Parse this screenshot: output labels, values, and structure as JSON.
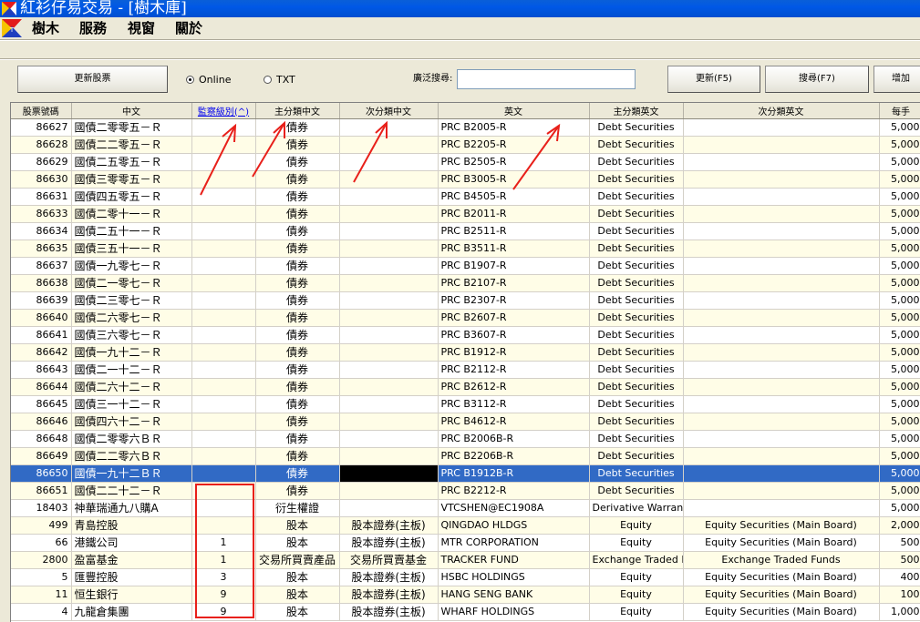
{
  "window": {
    "title": "紅衫仔易交易 - [樹木庫]"
  },
  "menu": [
    "樹木",
    "服務",
    "視窗",
    "關於"
  ],
  "toolbar": {
    "refresh_stocks": "更新股票",
    "online_label": "Online",
    "txt_label": "TXT",
    "search_label": "廣泛搜尋:",
    "search_value": "",
    "update_label": "更新(F5)",
    "search_label_btn": "搜尋(F7)",
    "add_label": "增加"
  },
  "table": {
    "columns": [
      "股票號碼",
      "中文",
      "監察級別(^)",
      "主分類中文",
      "次分類中文",
      "英文",
      "主分類英文",
      "次分類英文",
      "每手"
    ],
    "rows": [
      [
        "86627",
        "國債二零零五－Ｒ",
        "",
        "債券",
        "",
        "PRC B2005-R",
        "Debt Securities",
        "",
        "5,000"
      ],
      [
        "86628",
        "國債二二零五－Ｒ",
        "",
        "債券",
        "",
        "PRC B2205-R",
        "Debt Securities",
        "",
        "5,000"
      ],
      [
        "86629",
        "國債二五零五－Ｒ",
        "",
        "債券",
        "",
        "PRC B2505-R",
        "Debt Securities",
        "",
        "5,000"
      ],
      [
        "86630",
        "國債三零零五－Ｒ",
        "",
        "債券",
        "",
        "PRC B3005-R",
        "Debt Securities",
        "",
        "5,000"
      ],
      [
        "86631",
        "國債四五零五－Ｒ",
        "",
        "債券",
        "",
        "PRC B4505-R",
        "Debt Securities",
        "",
        "5,000"
      ],
      [
        "86633",
        "國債二零十一－Ｒ",
        "",
        "債券",
        "",
        "PRC B2011-R",
        "Debt Securities",
        "",
        "5,000"
      ],
      [
        "86634",
        "國債二五十一－Ｒ",
        "",
        "債券",
        "",
        "PRC B2511-R",
        "Debt Securities",
        "",
        "5,000"
      ],
      [
        "86635",
        "國債三五十一－Ｒ",
        "",
        "債券",
        "",
        "PRC B3511-R",
        "Debt Securities",
        "",
        "5,000"
      ],
      [
        "86637",
        "國債一九零七－Ｒ",
        "",
        "債券",
        "",
        "PRC B1907-R",
        "Debt Securities",
        "",
        "5,000"
      ],
      [
        "86638",
        "國債二一零七－Ｒ",
        "",
        "債券",
        "",
        "PRC B2107-R",
        "Debt Securities",
        "",
        "5,000"
      ],
      [
        "86639",
        "國債二三零七－Ｒ",
        "",
        "債券",
        "",
        "PRC B2307-R",
        "Debt Securities",
        "",
        "5,000"
      ],
      [
        "86640",
        "國債二六零七－Ｒ",
        "",
        "債券",
        "",
        "PRC B2607-R",
        "Debt Securities",
        "",
        "5,000"
      ],
      [
        "86641",
        "國債三六零七－Ｒ",
        "",
        "債券",
        "",
        "PRC B3607-R",
        "Debt Securities",
        "",
        "5,000"
      ],
      [
        "86642",
        "國債一九十二－Ｒ",
        "",
        "債券",
        "",
        "PRC B1912-R",
        "Debt Securities",
        "",
        "5,000"
      ],
      [
        "86643",
        "國債二一十二－Ｒ",
        "",
        "債券",
        "",
        "PRC B2112-R",
        "Debt Securities",
        "",
        "5,000"
      ],
      [
        "86644",
        "國債二六十二－Ｒ",
        "",
        "債券",
        "",
        "PRC B2612-R",
        "Debt Securities",
        "",
        "5,000"
      ],
      [
        "86645",
        "國債三一十二－Ｒ",
        "",
        "債券",
        "",
        "PRC B3112-R",
        "Debt Securities",
        "",
        "5,000"
      ],
      [
        "86646",
        "國債四六十二－Ｒ",
        "",
        "債券",
        "",
        "PRC B4612-R",
        "Debt Securities",
        "",
        "5,000"
      ],
      [
        "86648",
        "國債二零零六ＢＲ",
        "",
        "債券",
        "",
        "PRC B2006B-R",
        "Debt Securities",
        "",
        "5,000"
      ],
      [
        "86649",
        "國債二二零六ＢＲ",
        "",
        "債券",
        "",
        "PRC B2206B-R",
        "Debt Securities",
        "",
        "5,000"
      ],
      [
        "86650",
        "國債一九十二ＢＲ",
        "",
        "債券",
        "",
        "PRC B1912B-R",
        "Debt Securities",
        "",
        "5,000"
      ],
      [
        "86651",
        "國債二二十二－Ｒ",
        "",
        "債券",
        "",
        "PRC B2212-R",
        "Debt Securities",
        "",
        "5,000"
      ],
      [
        "18403",
        "神華瑞通九八購A",
        "",
        "衍生權證",
        "",
        "VTCSHEN@EC1908A",
        "Derivative Warrants",
        "",
        "5,000"
      ],
      [
        "499",
        "青島控股",
        "",
        "股本",
        "股本證券(主板)",
        "QINGDAO HLDGS",
        "Equity",
        "Equity Securities (Main Board)",
        "2,000"
      ],
      [
        "66",
        "港鐵公司",
        "1",
        "股本",
        "股本證券(主板)",
        "MTR CORPORATION",
        "Equity",
        "Equity Securities (Main Board)",
        "500"
      ],
      [
        "2800",
        "盈富基金",
        "1",
        "交易所買賣產品",
        "交易所買賣基金",
        "TRACKER FUND",
        "Exchange Traded Products",
        "Exchange Traded Funds",
        "500"
      ],
      [
        "5",
        "匯豐控股",
        "3",
        "股本",
        "股本證券(主板)",
        "HSBC HOLDINGS",
        "Equity",
        "Equity Securities (Main Board)",
        "400"
      ],
      [
        "11",
        "恒生銀行",
        "9",
        "股本",
        "股本證券(主板)",
        "HANG SENG BANK",
        "Equity",
        "Equity Securities (Main Board)",
        "100"
      ],
      [
        "4",
        "九龍倉集團",
        "9",
        "股本",
        "股本證券(主板)",
        "WHARF HOLDINGS",
        "Equity",
        "Equity Securities (Main Board)",
        "1,000"
      ]
    ],
    "selected_row": 20,
    "colors": {
      "selection": "#316ac5",
      "alt_row": "#fffde7",
      "annotation": "#e8201a"
    }
  }
}
